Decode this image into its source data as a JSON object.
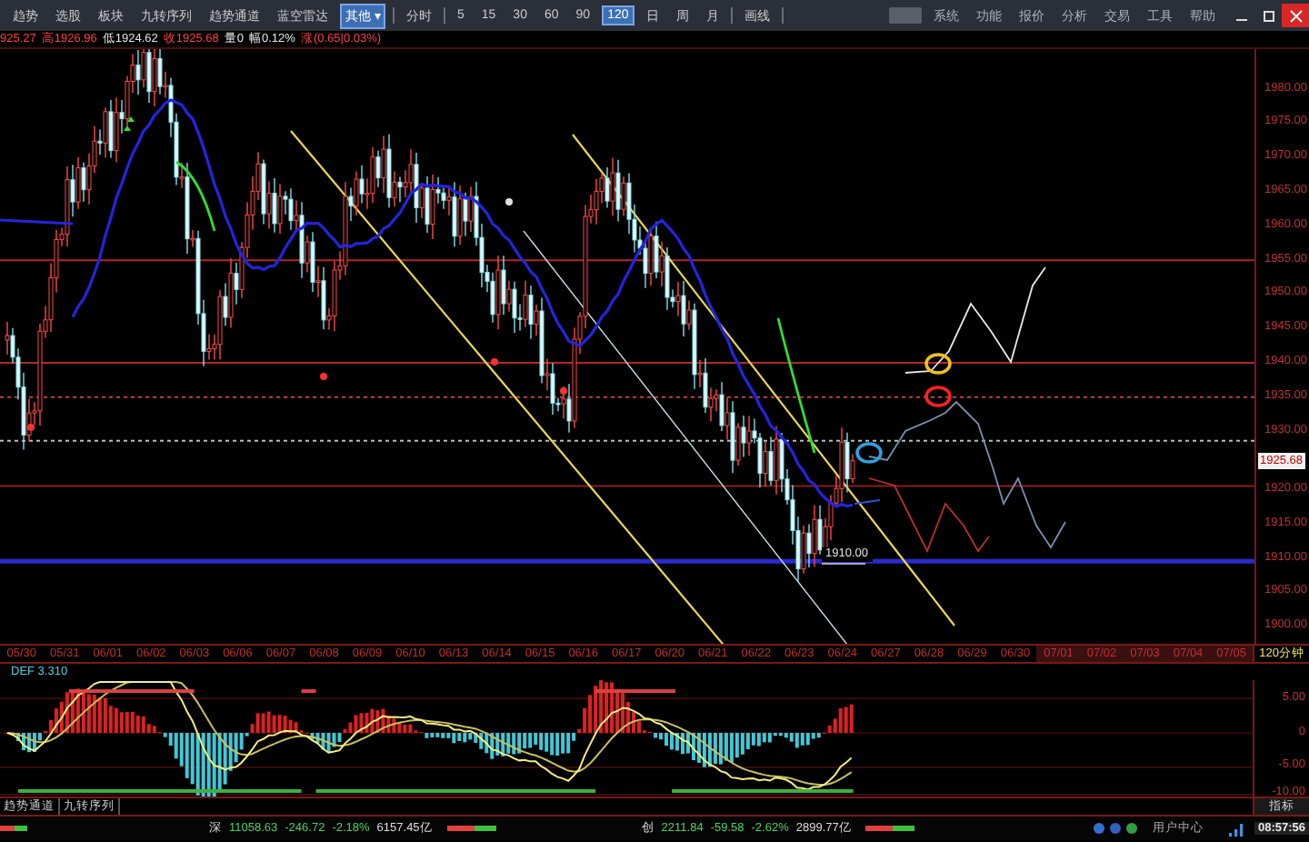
{
  "toolbar": {
    "tools": [
      {
        "label": "趋势",
        "selected": false
      },
      {
        "label": "选股",
        "selected": false
      },
      {
        "label": "板块",
        "selected": false
      },
      {
        "label": "九转序列",
        "selected": false
      },
      {
        "label": "趋势通道",
        "selected": false
      },
      {
        "label": "蓝空雷达",
        "selected": false
      },
      {
        "label": "其他 ▾",
        "selected": true
      }
    ],
    "view": "分时",
    "periods": [
      {
        "label": "5",
        "selected": false
      },
      {
        "label": "15",
        "selected": false
      },
      {
        "label": "30",
        "selected": false
      },
      {
        "label": "60",
        "selected": false
      },
      {
        "label": "90",
        "selected": false
      },
      {
        "label": "120",
        "selected": true
      },
      {
        "label": "日",
        "selected": false
      },
      {
        "label": "周",
        "selected": false
      },
      {
        "label": "月",
        "selected": false
      }
    ],
    "draw": "画线",
    "menu": [
      "系统",
      "功能",
      "报价",
      "分析",
      "交易",
      "工具",
      "帮助"
    ]
  },
  "info_line": [
    {
      "text": "925.27",
      "kind": "down"
    },
    {
      "text": "高1926.96",
      "kind": "down"
    },
    {
      "text": "低1924.62",
      "kind": "plain"
    },
    {
      "text": "收1925.68",
      "kind": "down"
    },
    {
      "text": "量0",
      "kind": "plain"
    },
    {
      "text": "幅0.12%",
      "kind": "plain"
    },
    {
      "text": "涨(0.65|0.03%)",
      "kind": "down"
    }
  ],
  "chart": {
    "level_label": "1910.00",
    "price_axis": [
      {
        "text": "1980.00",
        "kind": "tick"
      },
      {
        "text": "1975.00",
        "kind": "tick"
      },
      {
        "text": "1970.00",
        "kind": "tick"
      },
      {
        "text": "1965.00",
        "kind": "tick"
      },
      {
        "text": "1960.00",
        "kind": "tick"
      },
      {
        "text": "1955.00",
        "kind": "tick"
      },
      {
        "text": "1950.00",
        "kind": "tick"
      },
      {
        "text": "1945.00",
        "kind": "tick"
      },
      {
        "text": "1940.00",
        "kind": "tick"
      },
      {
        "text": "1935.00",
        "kind": "tick"
      },
      {
        "text": "1930.00",
        "kind": "tick"
      },
      {
        "text": "1925.68",
        "kind": "current"
      },
      {
        "text": "1920.00",
        "kind": "tick"
      },
      {
        "text": "1915.00",
        "kind": "tick"
      },
      {
        "text": "1910.00",
        "kind": "tick"
      },
      {
        "text": "1905.00",
        "kind": "tick"
      },
      {
        "text": "1900.00",
        "kind": "tick"
      }
    ]
  },
  "date_axis": {
    "dates": [
      {
        "text": "05/30",
        "future": false
      },
      {
        "text": "05/31",
        "future": false
      },
      {
        "text": "06/01",
        "future": false
      },
      {
        "text": "06/02",
        "future": false
      },
      {
        "text": "06/03",
        "future": false
      },
      {
        "text": "06/06",
        "future": false
      },
      {
        "text": "06/07",
        "future": false
      },
      {
        "text": "06/08",
        "future": false
      },
      {
        "text": "06/09",
        "future": false
      },
      {
        "text": "06/10",
        "future": false
      },
      {
        "text": "06/13",
        "future": false
      },
      {
        "text": "06/14",
        "future": false
      },
      {
        "text": "06/15",
        "future": false
      },
      {
        "text": "06/16",
        "future": false
      },
      {
        "text": "06/17",
        "future": false
      },
      {
        "text": "06/20",
        "future": false
      },
      {
        "text": "06/21",
        "future": false
      },
      {
        "text": "06/22",
        "future": false
      },
      {
        "text": "06/23",
        "future": false
      },
      {
        "text": "06/24",
        "future": false
      },
      {
        "text": "06/27",
        "future": false
      },
      {
        "text": "06/28",
        "future": false
      },
      {
        "text": "06/29",
        "future": false
      },
      {
        "text": "06/30",
        "future": false
      },
      {
        "text": "07/01",
        "future": true
      },
      {
        "text": "07/02",
        "future": true
      },
      {
        "text": "07/03",
        "future": true
      },
      {
        "text": "07/04",
        "future": true
      },
      {
        "text": "07/05",
        "future": true
      }
    ],
    "period": "120分钟"
  },
  "indicator": {
    "label": "DEF 3.310",
    "axis": [
      "5.00",
      "0",
      "-5.00",
      "-10.00"
    ],
    "name": "指标"
  },
  "bottom_tabs": [
    {
      "label": "趋势通道",
      "selected": false
    },
    {
      "label": "九转序列",
      "selected": false
    }
  ],
  "status_bar": {
    "markets": [
      {
        "name": "深",
        "value": "11058.63",
        "change": "-246.72",
        "percent": "-2.18%",
        "amount": "6157.45亿"
      },
      {
        "name": "创",
        "value": "2211.84",
        "change": "-59.58",
        "percent": "-2.62%",
        "amount": "2899.77亿"
      }
    ],
    "user_center": "用户中心",
    "time": "08:57:56"
  }
}
